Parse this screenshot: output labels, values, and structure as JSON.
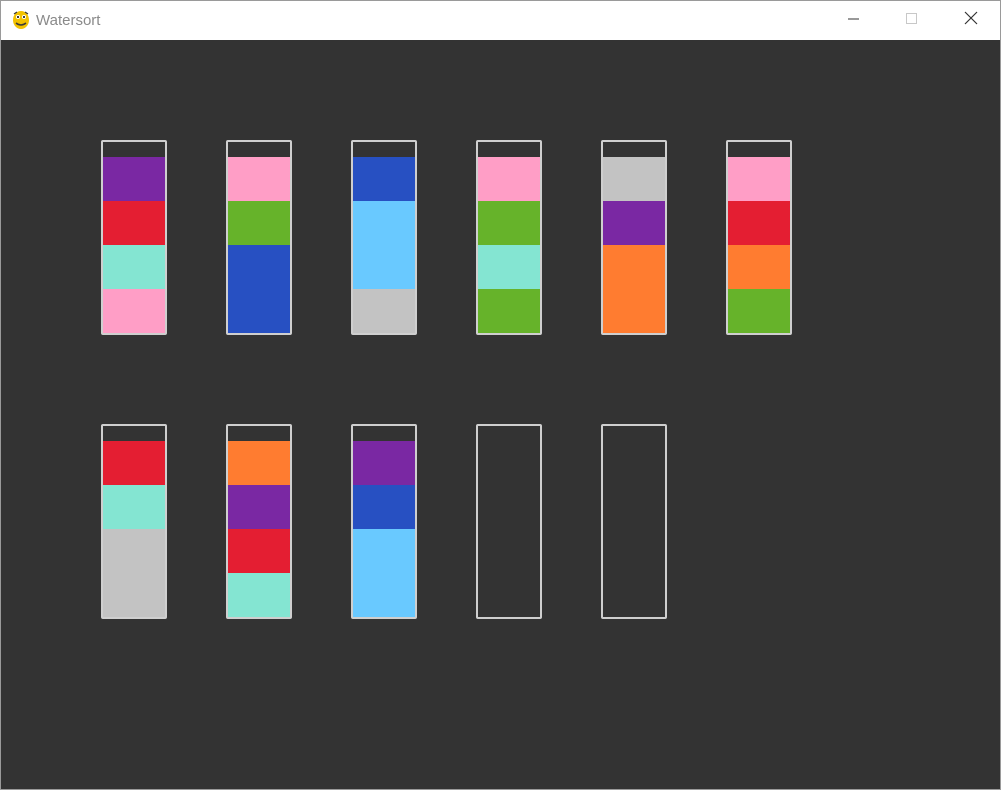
{
  "window": {
    "title": "Watersort",
    "app_icon": "python-snake-icon",
    "controls": [
      "minimize-icon",
      "maximize-icon",
      "close-icon"
    ]
  },
  "game": {
    "tube_capacity": 4,
    "background_color": "#333333",
    "tube_border_color": "#cfcfcf",
    "palette": {
      "purple": "#7a28a3",
      "red": "#e41e32",
      "mint": "#84e5d2",
      "pink": "#ff9ec6",
      "green": "#66b32a",
      "blue": "#2750c2",
      "sky": "#69c9ff",
      "gray": "#c3c3c3",
      "orange": "#ff7c30"
    },
    "rows": [
      [
        [
          "purple",
          "red",
          "mint",
          "pink"
        ],
        [
          "pink",
          "green",
          "blue",
          "blue"
        ],
        [
          "blue",
          "sky",
          "sky",
          "gray"
        ],
        [
          "pink",
          "green",
          "mint",
          "green"
        ],
        [
          "gray",
          "purple",
          "orange",
          "orange"
        ],
        [
          "pink",
          "red",
          "orange",
          "green"
        ]
      ],
      [
        [
          "red",
          "mint",
          "gray",
          "gray"
        ],
        [
          "orange",
          "purple",
          "red",
          "mint"
        ],
        [
          "purple",
          "blue",
          "sky",
          "sky"
        ],
        [],
        []
      ]
    ]
  }
}
